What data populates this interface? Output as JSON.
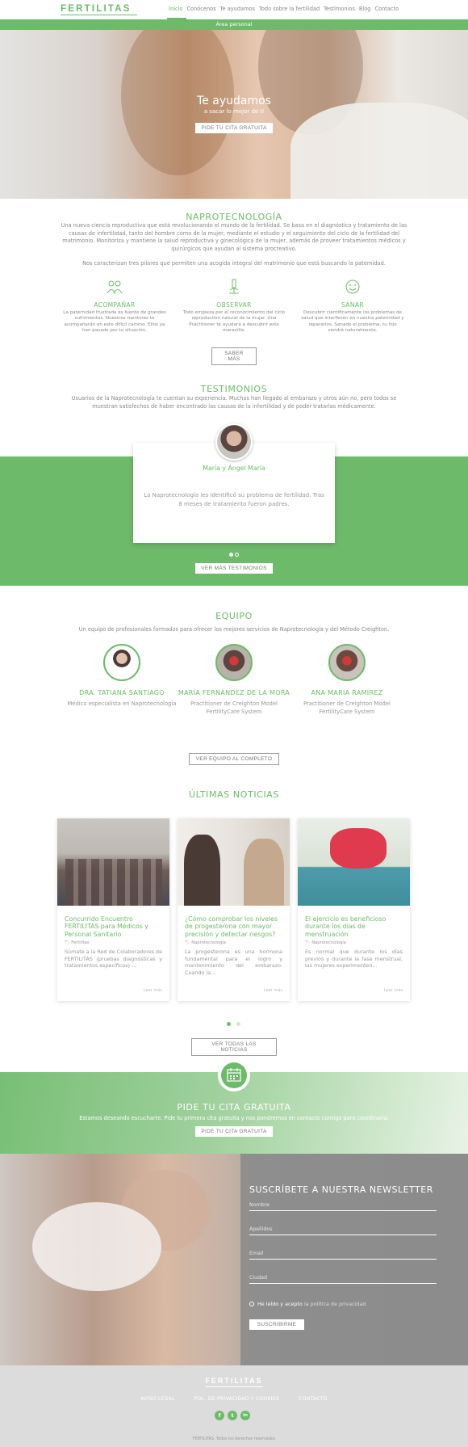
{
  "header": {
    "logo": "FERTILITAS",
    "nav": [
      "Inicio",
      "Conócenos",
      "Te ayudamos",
      "Todo sobre la fertilidad",
      "Testimonios",
      "Blog",
      "Contacto"
    ],
    "active": "Inicio"
  },
  "area_bar": "Área personal",
  "hero": {
    "title": "Te ayudamos",
    "subtitle": "a sacar lo mejor de ti",
    "cta": "PIDE TU CITA GRATUITA"
  },
  "napro": {
    "title": "NAPROTECNOLOGÍA",
    "intro": "Una nueva ciencia reproductiva que está revolucionando el mundo de la fertilidad. Se basa en el diagnóstico y tratamiento de las causas de infertilidad, tanto del hombre como de la mujer, mediante el estudio y el seguimiento del ciclo de la fertilidad del matrimonio. Monitoriza y mantiene la salud reproductiva y ginecológica de la mujer, además de proveer tratamientos médicos y quirúrgicos que ayudan al sistema procreativo.",
    "pillars_intro": "Nos caracterizan tres pilares que permiten una acogida integral del matrimonio que está buscando la paternidad.",
    "pillars": [
      {
        "icon": "couple-icon",
        "title": "ACOMPAÑAR",
        "text": "La paternidad frustrada es fuente de grandes sufrimientos. Nuestros mentores te acompañarán en este difícil camino. Ellos ya han pasado por tu situación."
      },
      {
        "icon": "microscope-icon",
        "title": "OBSERVAR",
        "text": "Todo empieza por el reconocimiento del ciclo reproductivo natural de la mujer. Una Practitioner te ayudará a descubrir esta maravilla."
      },
      {
        "icon": "smile-face-icon",
        "title": "SANAR",
        "text": "Descubrir científicamente los problemas de salud que interfieren en nuestra paternidad y repararlos. Sanado el problema, tu hijo vendrá naturalmente."
      }
    ],
    "more": "SABER MÁS"
  },
  "testimonials": {
    "title": "TESTIMONIOS",
    "intro": "Usuarios de la Naprotecnología te cuentan su experiencia. Muchos han llegado al embarazo y otros aún no, pero todos se muestran satisfechos de haber encontrado las causas de la infertilidad y de poder tratarlas médicamente.",
    "name": "María y Ángel María",
    "quote": "La Naprotecnología les identificó su problema de fertilidad. Tras 8 meses de tratamiento fueron padres.",
    "more": "VER MÁS TESTIMONIOS"
  },
  "team": {
    "title": "EQUIPO",
    "intro": "Un equipo de profesionales formados para ofrecer los mejores servicios de Naprotecnología y del Método Creighton.",
    "members": [
      {
        "name": "DRA. TATIANA SANTIAGO",
        "role": "Médico especialista en Naprotecnología"
      },
      {
        "name": "MARÍA FERNÁNDEZ DE LA MORA",
        "role": "Practitioner de Creighton Model FertilityCare System"
      },
      {
        "name": "ANA MARÍA RAMÍREZ",
        "role": "Practitioner de Creighton Model FertilityCare System"
      }
    ],
    "more": "VER EQUIPO AL COMPLETO"
  },
  "news": {
    "title": "ÚLTIMAS NOTICIAS",
    "items": [
      {
        "title": "Concurrido Encuentro FERTILITAS para Médicos y Personal Sanitario",
        "tag": "Fertilitas",
        "excerpt": "Súmate a la Red de Colaboradores de FERTILITAS (pruebas diagnósticas y tratamientos específicos) ...",
        "more": "Leer más"
      },
      {
        "title": "¿Cómo comprobar los niveles de progesterona con mayor precisión y detectar riesgos?",
        "tag": "Naprotecnología",
        "excerpt": "La progesterona es una hormona fundamental para el logro y mantenimiento del embarazo. Cuando la...",
        "more": "Leer más"
      },
      {
        "title": "El ejercicio es beneficioso durante los días de menstruación",
        "tag": "Naprotecnología",
        "excerpt": "Es normal que durante los días previos y durante la fase menstrual, las mujeres experimenten...",
        "more": "Leer más"
      }
    ],
    "more": "VER TODAS LAS NOTICIAS"
  },
  "cita": {
    "title": "PIDE TU CITA GRATUITA",
    "text": "Estamos deseando escucharte. Pide tu primera cita gratuita y nos pondremos en contacto contigo para coordinarla.",
    "button": "PIDE TU CITA GRATUITA"
  },
  "newsletter": {
    "title": "SUSCRÍBETE A NUESTRA NEWSLETTER",
    "fields": [
      "Nombre",
      "Apellidos",
      "Email",
      "Ciudad"
    ],
    "consent_prefix": "He leído y acepto",
    "consent_link": "la política de privacidad",
    "button": "SUSCRIBIRME"
  },
  "footer": {
    "logo": "FERTILITAS",
    "links": [
      "AVISO LEGAL",
      "POL. DE PRIVACIDAD Y COOKIES",
      "CONTACTO"
    ],
    "social": [
      "f",
      "t",
      "in"
    ],
    "copyright": "FERTILITAS. Todos los derechos reservados"
  },
  "colors": {
    "accent": "#6dbb6a",
    "panel": "#8c8c8c",
    "footer": "#dcdcdc"
  }
}
